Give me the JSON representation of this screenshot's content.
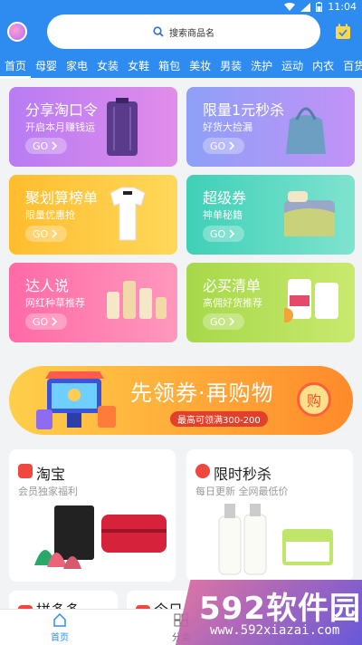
{
  "status": {
    "time": "11:04"
  },
  "search": {
    "placeholder": "搜索商品名"
  },
  "categories": [
    "首页",
    "母婴",
    "家电",
    "女装",
    "女鞋",
    "箱包",
    "美妆",
    "男装",
    "洗护",
    "运动",
    "内衣",
    "百货"
  ],
  "promos": [
    {
      "title": "分享淘口令",
      "subtitle": "开启本月赚钱运",
      "go": "GO",
      "color_from": "#b87cf3",
      "color_to": "#e18cea"
    },
    {
      "title": "限量1元秒杀",
      "subtitle": "好货大捡漏",
      "go": "GO",
      "color_from": "#8ea0f7",
      "color_to": "#c292f7"
    },
    {
      "title": "聚划算榜单",
      "subtitle": "限量优惠抢",
      "go": "GO",
      "color_from": "#ffbd2e",
      "color_to": "#ffd85a"
    },
    {
      "title": "超级券",
      "subtitle": "神单秘籍",
      "go": "GO",
      "color_from": "#3fd0b7",
      "color_to": "#7fe3cf"
    },
    {
      "title": "达人说",
      "subtitle": "网红种草推荐",
      "go": "GO",
      "color_from": "#ff6aa6",
      "color_to": "#ff98bd"
    },
    {
      "title": "必买清单",
      "subtitle": "高佣好货推荐",
      "go": "GO",
      "color_from": "#a6d84a",
      "color_to": "#c9e96e"
    }
  ],
  "banner": {
    "title": "先领券·再购物",
    "pill": "最高可领满300-200",
    "coin": "购"
  },
  "cards": [
    {
      "title": "淘宝",
      "subtitle": "会员独家福利",
      "icon_color": "#f0483e"
    },
    {
      "title": "限时秒杀",
      "subtitle": "每日更新  全网最低价",
      "icon_color": "#f0483e"
    }
  ],
  "partial_cards": [
    {
      "title": "拼多多"
    },
    {
      "title": "今日"
    }
  ],
  "bottomnav": [
    {
      "label": "首页"
    },
    {
      "label": "分类"
    }
  ],
  "watermark": {
    "brand": "592软件园",
    "url": "www.592xiazai.com"
  },
  "colors": {
    "header": "#2e8bf0",
    "accent_red": "#f0483e"
  }
}
